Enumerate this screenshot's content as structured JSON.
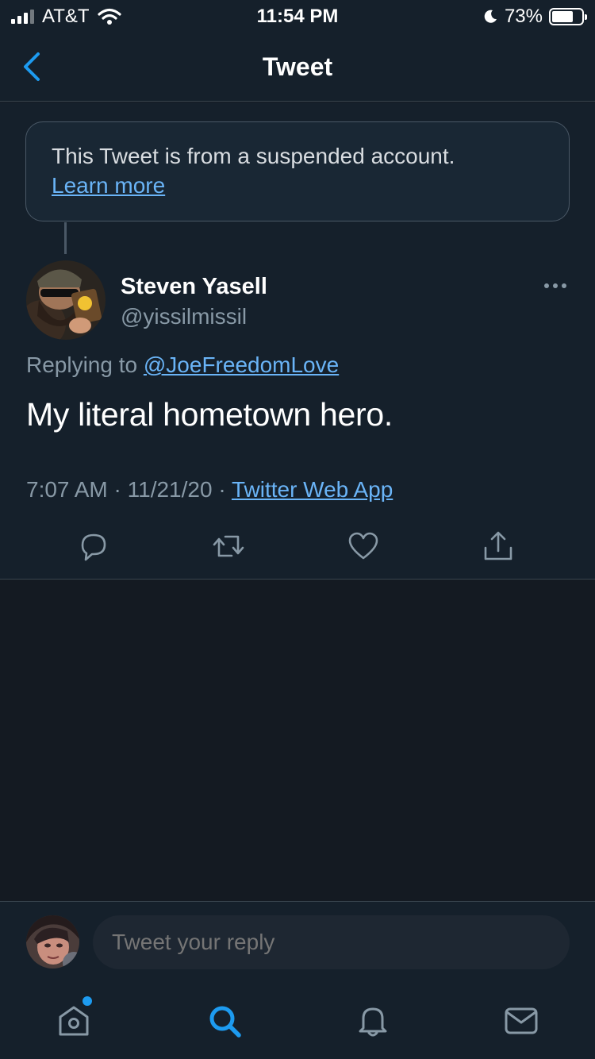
{
  "status_bar": {
    "carrier": "AT&T",
    "time": "11:54 PM",
    "battery_percent": "73%",
    "battery_level": 0.73
  },
  "nav": {
    "title": "Tweet"
  },
  "notice": {
    "text": "This Tweet is from a suspended account.",
    "link": "Learn more"
  },
  "tweet": {
    "author_name": "Steven Yasell",
    "author_handle": "@yissilmissil",
    "replying_prefix": "Replying to",
    "replying_to": "@JoeFreedomLove",
    "text": "My literal hometown hero.",
    "time": "7:07 AM",
    "separator": "·",
    "date": "11/21/20",
    "source": "Twitter Web App"
  },
  "reply": {
    "placeholder": "Tweet your reply"
  },
  "colors": {
    "accent": "#1d9bf0",
    "link": "#6ab4f7",
    "background": "#15202b",
    "secondary_text": "#8899a6"
  },
  "icons": {
    "actions": [
      "reply-icon",
      "retweet-icon",
      "like-icon",
      "share-icon"
    ],
    "tabs": [
      "home-icon",
      "search-icon",
      "notifications-icon",
      "messages-icon"
    ]
  }
}
